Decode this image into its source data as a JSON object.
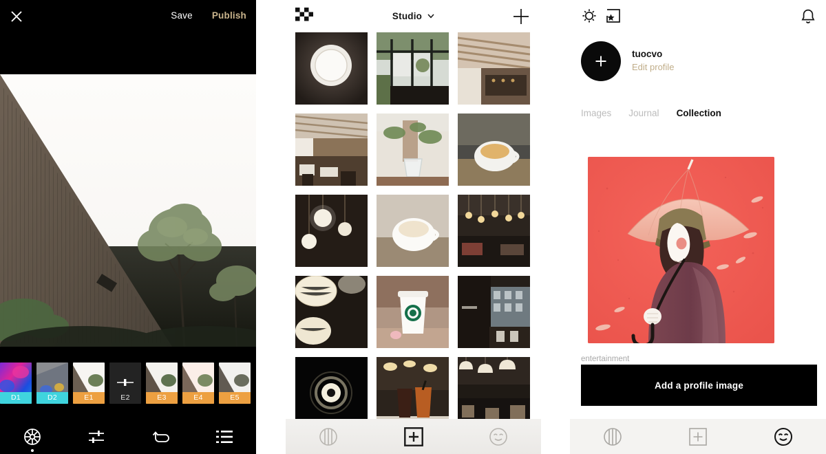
{
  "editor": {
    "close_icon": "close-icon",
    "save_label": "Save",
    "publish_label": "Publish",
    "publish_color": "#c9b48c",
    "photo_alt": "wooden-building-with-trees",
    "filters": [
      {
        "id": "D1",
        "label": "D1",
        "tone": "cyan",
        "selected": false
      },
      {
        "id": "D2",
        "label": "D2",
        "tone": "cyan",
        "selected": false
      },
      {
        "id": "E1",
        "label": "E1",
        "tone": "orange",
        "selected": false
      },
      {
        "id": "E2",
        "label": "E2",
        "tone": "dark",
        "selected": true
      },
      {
        "id": "E3",
        "label": "E3",
        "tone": "orange",
        "selected": false
      },
      {
        "id": "E4",
        "label": "E4",
        "tone": "orange",
        "selected": false
      },
      {
        "id": "E5",
        "label": "E5",
        "tone": "orange",
        "selected": false
      }
    ],
    "toolbar": [
      {
        "icon": "filter-wheel-icon",
        "active": true
      },
      {
        "icon": "adjust-sliders-icon",
        "active": false
      },
      {
        "icon": "undo-icon",
        "active": false
      },
      {
        "icon": "list-icon",
        "active": false
      }
    ],
    "colors": {
      "cyan_label": "#3fd4de",
      "orange_label": "#eda041",
      "background": "#000000"
    }
  },
  "feed": {
    "logo_icon": "checker-logo-icon",
    "title": "Studio",
    "title_chevron": "chevron-down-icon",
    "add_icon": "plus-icon",
    "grid": [
      [
        "dark-plate-light",
        "window-plants-cafe",
        "wooden-ceiling-bar"
      ],
      [
        "cafe-interior-wide",
        "glass-bowl-plants",
        "latte-cup-window"
      ],
      [
        "hanging-bulb-dark",
        "latte-cup-white",
        "pendant-lights-bar"
      ],
      [
        "paper-lanterns",
        "starbucks-cup",
        "night-cafe-street"
      ],
      [
        "dark-ring-light",
        "iced-drinks-cafe",
        "cafe-pendant-room"
      ]
    ],
    "bottom_nav": [
      {
        "icon": "contrast-circle-icon",
        "active": false
      },
      {
        "icon": "plus-square-icon",
        "active": true
      },
      {
        "icon": "smiley-icon",
        "active": false
      }
    ]
  },
  "profile": {
    "gear_icon": "gear-icon",
    "frame_icon": "star-frame-icon",
    "bell_icon": "bell-icon",
    "avatar_icon": "plus-icon",
    "username": "tuocvo",
    "edit_profile_label": "Edit profile",
    "edit_profile_color": "#c0ad89",
    "tabs": [
      {
        "label": "Images",
        "active": false
      },
      {
        "label": "Journal",
        "active": false
      },
      {
        "label": "Collection",
        "active": true
      }
    ],
    "illustration_alt": "woman-with-umbrella-illustration",
    "illustration_color": "#f0584f",
    "caption": "entertainment",
    "toast_label": "Add a profile image",
    "bottom_nav": [
      {
        "icon": "contrast-circle-icon",
        "active": false
      },
      {
        "icon": "plus-square-icon",
        "active": false
      },
      {
        "icon": "smiley-icon",
        "active": true
      }
    ]
  }
}
